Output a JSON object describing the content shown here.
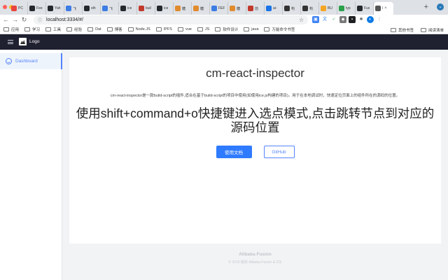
{
  "browser": {
    "tabs": [
      {
        "label": "PC",
        "icon": "pc-icon",
        "color": "#e8453c"
      },
      {
        "label": "Fee",
        "icon": "github-icon",
        "color": "#24292e"
      },
      {
        "label": "Yah",
        "icon": "github-icon",
        "color": "#24292e"
      },
      {
        "label": "飞",
        "icon": "diamond-icon",
        "color": "#3d7de4"
      },
      {
        "label": "sth",
        "icon": "github-icon",
        "color": "#24292e"
      },
      {
        "label": "飞",
        "icon": "diamond-icon",
        "color": "#3d7de4"
      },
      {
        "label": "ice",
        "icon": "github-icon",
        "color": "#24292e"
      },
      {
        "label": "buil",
        "icon": "juejin-icon",
        "color": "#c0392b"
      },
      {
        "label": "ice",
        "icon": "github-icon",
        "color": "#24292e"
      },
      {
        "label": "糖",
        "icon": "sf-icon",
        "color": "#e08b2e"
      },
      {
        "label": "糖",
        "icon": "sf-icon",
        "color": "#e08b2e"
      },
      {
        "label": "FEF",
        "icon": "diamond-icon",
        "color": "#3d7de4"
      },
      {
        "label": "糖",
        "icon": "sf-icon",
        "color": "#e08b2e"
      },
      {
        "label": "前",
        "icon": "juejin-icon",
        "color": "#c0392b"
      },
      {
        "label": "ai-",
        "icon": "ai-icon",
        "color": "#1a73e8"
      },
      {
        "label": "构",
        "icon": "umbrella-icon",
        "color": "#333333"
      },
      {
        "label": "构",
        "icon": "umbrella-icon",
        "color": "#333333"
      },
      {
        "label": "BU",
        "icon": "bu-icon",
        "color": "#f5a623"
      },
      {
        "label": "typ",
        "icon": "ts-icon",
        "color": "#2aa04a"
      },
      {
        "label": "Fus",
        "icon": "github-icon",
        "color": "#24292e"
      },
      {
        "label": "l",
        "icon": "chrome-icon",
        "color": "#555555",
        "active": true
      }
    ],
    "url": "localhost:3334/#/",
    "bookmarks": [
      "应用",
      "学习",
      "工具",
      "经验",
      "Dat",
      "博客",
      "Node.JS",
      "IPFS",
      "vue",
      "JS",
      "软件设计",
      "java",
      "万能命令书签"
    ],
    "bookmarks_right": [
      "其他书签",
      "阅读清单"
    ]
  },
  "app": {
    "logo_text": "Logo",
    "menu": [
      {
        "label": "Dashboard",
        "icon": "smile-icon",
        "selected": true
      }
    ]
  },
  "main": {
    "title": "cm-react-inspector",
    "description": "cm-react-inspector是一款build-script的插件,适合在基于build-script的项目中使用(如使用ice.js构建的项目)。用于在本地调试时，快速定位页面上的组件所在的源码的位置。",
    "hint": "使用shift+command+o快捷键进入选点模式,点击跳转节点到对应的源码位置",
    "primary_button": "使用文档",
    "secondary_button": "GitHub"
  },
  "footer": {
    "brand": "Alibaba Fusion",
    "copyright": "© 2019 版权 Alibaba Fusion & ICE"
  },
  "colors": {
    "primary": "#2f7bff",
    "header_bg": "#1f2130"
  }
}
